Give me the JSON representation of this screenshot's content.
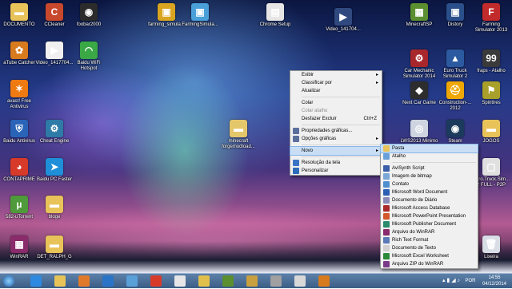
{
  "desktop_icons": [
    {
      "label": "DOCUMENTO",
      "color": "#e8c35a",
      "glyph": "▬"
    },
    {
      "label": "CCleaner",
      "color": "#c8482d",
      "glyph": "C"
    },
    {
      "label": "foobar2000",
      "color": "#2b2b2b",
      "glyph": "◉"
    },
    {
      "label": "farming_simula...",
      "color": "#d9a520",
      "glyph": "▣"
    },
    {
      "label": "FarmingSimula...",
      "color": "#4aa0d9",
      "glyph": "▣"
    },
    {
      "label": "Chrome Setup",
      "color": "#e6e6e6",
      "glyph": "▤"
    },
    {
      "label": "Video_141704...",
      "color": "#304a80",
      "glyph": "▶"
    },
    {
      "label": "MinecraftSP",
      "color": "#5b8f2f",
      "glyph": "▦"
    },
    {
      "label": "Distory",
      "color": "#2b4f8a",
      "glyph": "▣"
    },
    {
      "label": "Farming Simulator 2013",
      "color": "#c22b2b",
      "glyph": "F"
    },
    {
      "label": "aTube Catcher",
      "color": "#d87a1e",
      "glyph": "✿"
    },
    {
      "label": "Video_1417704...",
      "color": "#f0f0f0",
      "glyph": "▶"
    },
    {
      "label": "Baidu WiFi Hotspot",
      "color": "#3aa845",
      "glyph": "◠"
    },
    {
      "label": "Car Mechanic Simulator 2014",
      "color": "#a8272b",
      "glyph": "⚙"
    },
    {
      "label": "Euro Truck Simulator 2",
      "color": "#2c5aa0",
      "glyph": "▲"
    },
    {
      "label": "fraps - Atalho",
      "color": "#3a3a3a",
      "glyph": "99"
    },
    {
      "label": "avast! Free Antivirus",
      "color": "#f07a12",
      "glyph": "✶"
    },
    {
      "label": "Next Car Game",
      "color": "#2d2d2d",
      "glyph": "◆"
    },
    {
      "label": "Construction-... 2012",
      "color": "#f0a800",
      "glyph": "⛑"
    },
    {
      "label": "Spintires",
      "color": "#a8a02a",
      "glyph": "⚑"
    },
    {
      "label": "Baidu Antivirus",
      "color": "#2a64b8",
      "glyph": "⛨"
    },
    {
      "label": "Cheat Engine",
      "color": "#2e7ba8",
      "glyph": "⚙"
    },
    {
      "label": "minecraft forgemodload...",
      "color": "#e5c76b",
      "glyph": "▬"
    },
    {
      "label": "LWS2013 Minimo",
      "color": "#cfd5e0",
      "glyph": "◎"
    },
    {
      "label": "Steam",
      "color": "#1b3a5c",
      "glyph": "◉"
    },
    {
      "label": "JOGOS",
      "color": "#e8c35a",
      "glyph": "▬"
    },
    {
      "label": "CONTAPRIME",
      "color": "#d83a2a",
      "glyph": "◕"
    },
    {
      "label": "Baidu PC Faster",
      "color": "#1e8fd8",
      "glyph": "➤"
    },
    {
      "label": "Euro.Truck.Sim... 2 FULL - P2P",
      "color": "#e0e0e0",
      "glyph": "▢"
    },
    {
      "label": "582-uTorrent",
      "color": "#4f9a3a",
      "glyph": "µ"
    },
    {
      "label": "bloge",
      "color": "#e8c35a",
      "glyph": "▬"
    },
    {
      "label": "WinRAR",
      "color": "#8a2b6b",
      "glyph": "▦"
    },
    {
      "label": "DET_RALPH_G",
      "color": "#e8c35a",
      "glyph": "▬"
    },
    {
      "label": "Lixeira",
      "color": "#d8dde6",
      "glyph": "🗑"
    }
  ],
  "context_menu": [
    {
      "label": "Exibir",
      "type": "submenu"
    },
    {
      "label": "Classificar por",
      "type": "submenu"
    },
    {
      "label": "Atualizar",
      "type": "item"
    },
    {
      "type": "sep"
    },
    {
      "label": "Colar",
      "type": "item"
    },
    {
      "label": "Colar atalho",
      "type": "disabled"
    },
    {
      "label": "Desfazer Excluir",
      "type": "item",
      "shortcut": "Ctrl+Z"
    },
    {
      "type": "sep"
    },
    {
      "label": "Propriedades gráficas...",
      "type": "item",
      "icon": "#5a6f9c"
    },
    {
      "label": "Opções gráficas",
      "type": "submenu",
      "icon": "#5a6f9c"
    },
    {
      "type": "sep"
    },
    {
      "label": "Novo",
      "type": "submenu",
      "highlight": true
    },
    {
      "type": "sep"
    },
    {
      "label": "Resolução da tela",
      "type": "item",
      "icon": "#3a74c4"
    },
    {
      "label": "Personalizar",
      "type": "item",
      "icon": "#2d6cb8"
    }
  ],
  "submenu_new": [
    {
      "label": "Pasta",
      "icon": "#e8c35a",
      "highlight": true
    },
    {
      "label": "Atalho",
      "icon": "#6aa0d8"
    },
    {
      "type": "sep"
    },
    {
      "label": "AviSynth Script",
      "icon": "#3b5fa8"
    },
    {
      "label": "Imagem de bitmap",
      "icon": "#7aa7d6"
    },
    {
      "label": "Contato",
      "icon": "#4f8fcf"
    },
    {
      "label": "Microsoft Word Document",
      "icon": "#2b5fb4"
    },
    {
      "label": "Documento de Diário",
      "icon": "#8a8ab8"
    },
    {
      "label": "Microsoft Access Database",
      "icon": "#a82a2a"
    },
    {
      "label": "Microsoft PowerPoint Presentation",
      "icon": "#d2572a"
    },
    {
      "label": "Microsoft Publisher Document",
      "icon": "#2a8a6b"
    },
    {
      "label": "Arquivo do WinRAR",
      "icon": "#8a2b6b"
    },
    {
      "label": "Rich Text Format",
      "icon": "#5a7ab8"
    },
    {
      "label": "Documento de Texto",
      "icon": "#d0d0d0"
    },
    {
      "label": "Microsoft Excel Worksheet",
      "icon": "#2a8a3a"
    },
    {
      "label": "Arquivo ZIP do WinRAR",
      "icon": "#7a3a8a"
    }
  ],
  "taskbar": {
    "apps": [
      {
        "name": "ie-icon",
        "color": "#2e8ae0"
      },
      {
        "name": "explorer-icon",
        "color": "#e8c35a"
      },
      {
        "name": "media-player-icon",
        "color": "#e07a2a"
      },
      {
        "name": "windows-icon",
        "color": "#2a74c8"
      },
      {
        "name": "network-icon",
        "color": "#5aa0d8"
      },
      {
        "name": "control-panel-icon",
        "color": "#d83a2a"
      },
      {
        "name": "chrome-icon",
        "color": "#e6e6e6"
      },
      {
        "name": "steam-icon",
        "color": "#e0c04a"
      },
      {
        "name": "minecraft-icon",
        "color": "#5b8f2f"
      },
      {
        "name": "farming-icon",
        "color": "#c8a040"
      },
      {
        "name": "game-icon",
        "color": "#a0a0a0"
      },
      {
        "name": "clock-app-icon",
        "color": "#d8d8d8"
      },
      {
        "name": "atube-icon",
        "color": "#d87a1e"
      }
    ],
    "language": "POR",
    "time": "14:55",
    "date": "04/12/2014"
  }
}
